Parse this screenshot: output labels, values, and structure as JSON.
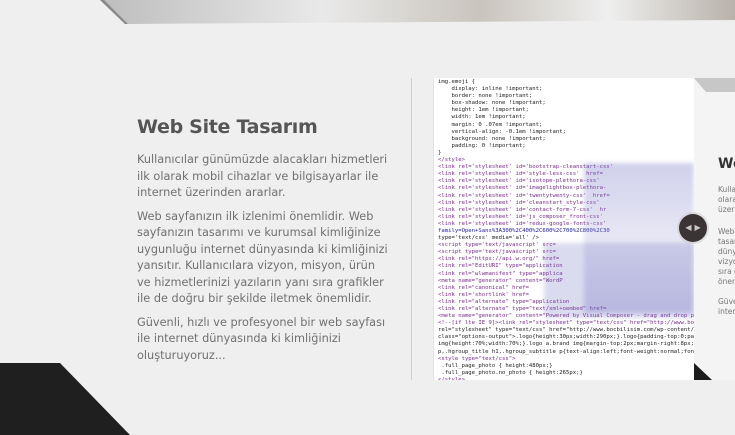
{
  "section": {
    "title": "Web Site Tasarım",
    "paragraphs": [
      "Kullanıcılar günümüzde alacakları hizmetleri ilk olarak mobil cihazlar ve bilgisayarlar ile internet üzerinden ararlar.",
      "Web sayfanızın ilk izlenimi önemlidir. Web sayfanızın tasarımı ve kurumsal kimliğinize uygunluğu internet dünyasında ki kimliğinizi yansıtır. Kullanıcılara vizyon, misyon, ürün ve hizmetlerinizi yazıların yanı sıra grafikler ile de doğru bir şekilde iletmek önemlidir.",
      "Güvenli, hızlı ve profesyonel bir web sayfası ile internet dünyasında ki kimliğinizi oluşturuyoruz..."
    ]
  },
  "code_lines": [
    "img.emoji {",
    "    display: inline !important;",
    "    border: none !important;",
    "    box-shadow: none !important;",
    "    height: 1em !important;",
    "    width: 1em !important;",
    "    margin: 0 .07em !important;",
    "    vertical-align: -0.1em !important;",
    "    background: none !important;",
    "    padding: 0 !important;",
    "}",
    "</style>",
    "<link rel='stylesheet' id='bootstrap-cleanstart-css'",
    "<link rel='stylesheet' id='style-less-css'  href=",
    "<link rel='stylesheet' id='isotope-plethora-css'",
    "<link rel='stylesheet' id='imagelightbox-plethora-",
    "<link rel='stylesheet' id='twentytwenty-css'  href=",
    "<link rel='stylesheet' id='cleanstart_style-css'",
    "<link rel='stylesheet' id='contact-form-7-css'  hr",
    "<link rel='stylesheet' id='js_composer_front-css'",
    "<link rel='stylesheet' id='redux-google-fonts-css'",
    "family=Open+Sans%3A300%2C400%2C600%2C700%2C800%2C30",
    "type='text/css' media='all' />",
    "<script type='text/javascript' src=",
    "<script type='text/javascript' src=",
    "<link rel=\"https://api.w.org/\" href=",
    "<link rel=\"EditURI\" type=\"application",
    "<link rel=\"wlwmanifest\" type=\"applica",
    "<meta name=\"generator\" content=\"WordP",
    "<link rel=\"canonical\" href=",
    "<link rel='shortlink' href=",
    "<link rel=\"alternate\" type=\"application",
    "<link rel=\"alternate\" type=\"text/xml+oembed\" href=",
    "<meta name=\"generator\" content=\"Powered by Visual Composer - drag and drop page",
    "<!--[if lte IE 9]><link rel=\"stylesheet\" type=\"text/css\" href=\"http://www.bocb",
    "rel=\"stylesheet\" type=\"text/css\" href=\"http://www.bocbilisim.com/wp-content/pl",
    "class=\"options-output\">.logo{height:30px;width:290px;}.logo{padding-top:0;padd",
    "img{height:70%;width:70%;}.logo a.brand img{margin-top:2px;margin-right:8px;ma",
    "p,.hgroup_title h1,.hgroup_subtitle p{text-align:left;font-weight:normal;font-",
    "<style type=\"text/css\">",
    " .full_page_photo { height:480px;}",
    " .full_page_photo.no_photo { height:265px;}",
    "</style>",
    "</head>"
  ],
  "next_slide": {
    "title": "We",
    "lines": [
      "Kulla",
      "olara",
      "üzeri",
      "Web",
      "tasar",
      "dünya",
      "vizyo",
      "sıra g",
      "önem",
      "Güve",
      "inter"
    ]
  },
  "nav": {
    "prev_glyph": "◀",
    "next_glyph": "▶"
  }
}
